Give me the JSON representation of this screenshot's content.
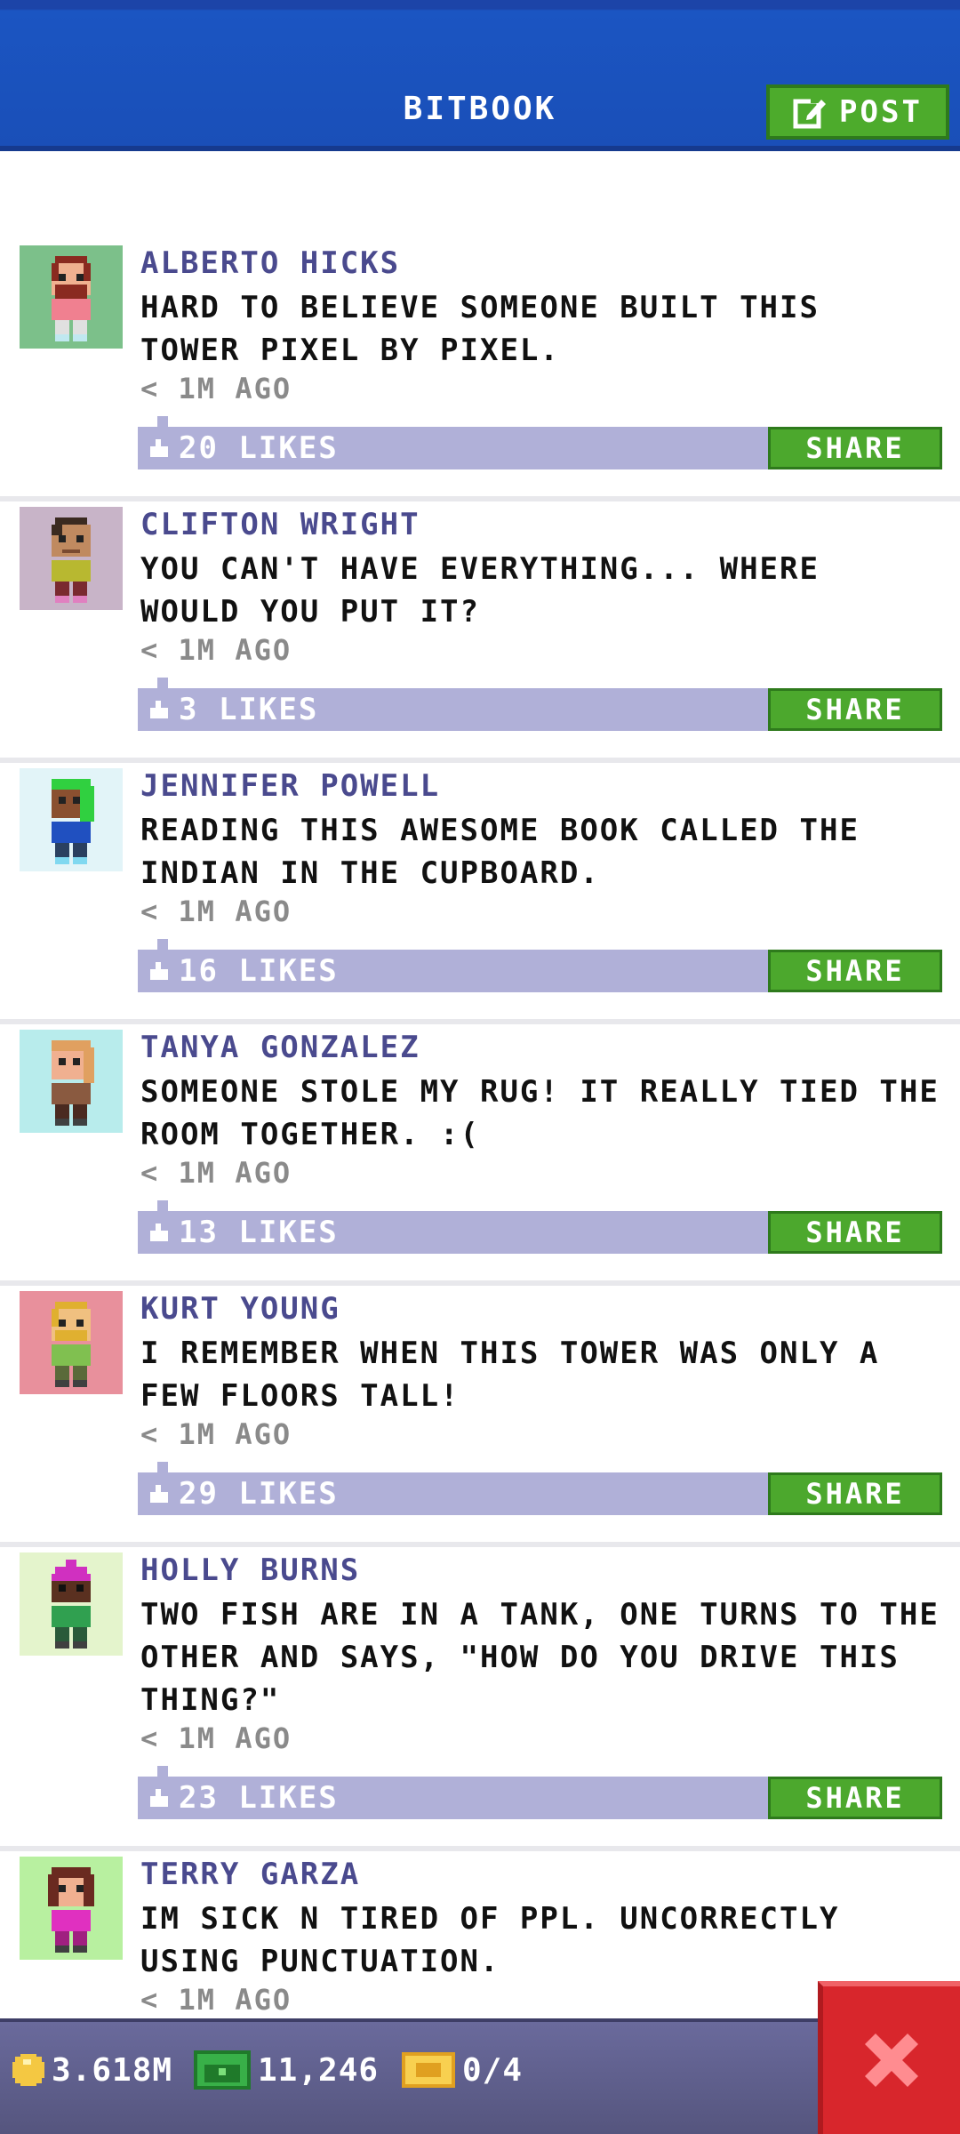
{
  "header": {
    "title": "BITBOOK",
    "post_label": "POST"
  },
  "posts": [
    {
      "author": "ALBERTO HICKS",
      "text": "HARD TO BELIEVE SOMEONE BUILT THIS\nTOWER PIXEL BY PIXEL.",
      "time": "< 1M AGO",
      "likes": "20 LIKES",
      "share": "SHARE",
      "avatar_bg": "#7cc08a",
      "avatar_icon": "bearded-man-avatar-icon"
    },
    {
      "author": "CLIFTON WRIGHT",
      "text": "YOU CAN'T HAVE EVERYTHING... WHERE\nWOULD YOU PUT IT?",
      "time": "< 1M AGO",
      "likes": "3 LIKES",
      "share": "SHARE",
      "avatar_bg": "#c8b4c8",
      "avatar_icon": "man-avatar-icon"
    },
    {
      "author": "JENNIFER POWELL",
      "text": "READING THIS AWESOME BOOK CALLED THE\nINDIAN IN THE CUPBOARD.",
      "time": "< 1M AGO",
      "likes": "16 LIKES",
      "share": "SHARE",
      "avatar_bg": "#e2f4f8",
      "avatar_icon": "green-hair-woman-avatar-icon"
    },
    {
      "author": "TANYA GONZALEZ",
      "text": "SOMEONE STOLE MY RUG! IT REALLY TIED THE\nROOM TOGETHER. :(",
      "time": "< 1M AGO",
      "likes": "13 LIKES",
      "share": "SHARE",
      "avatar_bg": "#b8ecec",
      "avatar_icon": "woman-avatar-icon"
    },
    {
      "author": "KURT YOUNG",
      "text": "I REMEMBER WHEN THIS TOWER WAS ONLY A\nFEW FLOORS TALL!",
      "time": "< 1M AGO",
      "likes": "29 LIKES",
      "share": "SHARE",
      "avatar_bg": "#e8909c",
      "avatar_icon": "blond-man-avatar-icon"
    },
    {
      "author": "HOLLY BURNS",
      "text": "TWO FISH ARE IN A TANK, ONE TURNS TO THE\nOTHER AND SAYS, \"HOW DO YOU DRIVE THIS\nTHING?\"",
      "time": "< 1M AGO",
      "likes": "23 LIKES",
      "share": "SHARE",
      "avatar_bg": "#e4f4cc",
      "avatar_icon": "pink-hat-woman-avatar-icon"
    },
    {
      "author": "TERRY GARZA",
      "text": "IM SICK N TIRED OF PPL. UNCORRECTLY\nUSING PUNCTUATION.",
      "time": "< 1M AGO",
      "likes": "",
      "share": "",
      "avatar_bg": "#b8f0a0",
      "avatar_icon": "pink-shirt-woman-avatar-icon"
    }
  ],
  "bottom_bar": {
    "coins": "3.618M",
    "bux": "11,246",
    "tickets": "0/4"
  },
  "colors": {
    "header": "#1a4fb8",
    "accent_green": "#4ca82d",
    "likes_bar": "#b0b0d8",
    "author": "#4a4a8e",
    "close": "#d8262c"
  }
}
